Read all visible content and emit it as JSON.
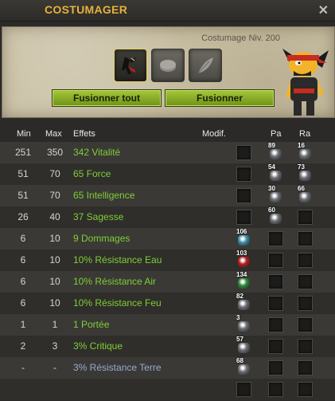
{
  "window": {
    "title": "COSTUMAGER",
    "close_glyph": "✕"
  },
  "header": {
    "level_text": "Costumage Niv. 200"
  },
  "slots": [
    {
      "icon": "dark-costume-item-icon",
      "selected": true
    },
    {
      "icon": "round-stone-icon",
      "selected": false
    },
    {
      "icon": "feather-icon",
      "selected": false
    }
  ],
  "buttons": {
    "merge_all": "Fusionner tout",
    "merge": "Fusionner"
  },
  "table": {
    "headers": {
      "min": "Min",
      "max": "Max",
      "effects": "Effets",
      "modif": "Modif.",
      "pa": "Pa",
      "ra": "Ra"
    },
    "rows": [
      {
        "min": "251",
        "max": "350",
        "effect": "342 Vitalité",
        "color": "green",
        "modif_rune": null,
        "pa": "89",
        "ra": "16"
      },
      {
        "min": "51",
        "max": "70",
        "effect": "65 Force",
        "color": "green",
        "modif_rune": null,
        "pa": "54",
        "ra": "73"
      },
      {
        "min": "51",
        "max": "70",
        "effect": "65 Intelligence",
        "color": "green",
        "modif_rune": null,
        "pa": "30",
        "ra": "66"
      },
      {
        "min": "26",
        "max": "40",
        "effect": "37 Sagesse",
        "color": "green",
        "modif_rune": null,
        "pa": "60",
        "ra": null
      },
      {
        "min": "6",
        "max": "10",
        "effect": "9 Dommages",
        "color": "green",
        "modif_rune": "106",
        "pa": null,
        "ra": null
      },
      {
        "min": "6",
        "max": "10",
        "effect": "10% Résistance Eau",
        "color": "green",
        "modif_rune": "103",
        "pa": null,
        "ra": null
      },
      {
        "min": "6",
        "max": "10",
        "effect": "10% Résistance Air",
        "color": "green",
        "modif_rune": "134",
        "pa": null,
        "ra": null
      },
      {
        "min": "6",
        "max": "10",
        "effect": "10% Résistance Feu",
        "color": "green",
        "modif_rune": "82",
        "pa": null,
        "ra": null
      },
      {
        "min": "1",
        "max": "1",
        "effect": "1 Portée",
        "color": "green",
        "modif_rune": "3",
        "pa": null,
        "ra": null
      },
      {
        "min": "2",
        "max": "3",
        "effect": "3% Critique",
        "color": "green",
        "modif_rune": "57",
        "pa": null,
        "ra": null
      },
      {
        "min": "-",
        "max": "-",
        "effect": "3% Résistance Terre",
        "color": "blue",
        "modif_rune": "68",
        "pa": null,
        "ra": null
      },
      {
        "min": "",
        "max": "",
        "effect": "",
        "color": "green",
        "modif_rune": null,
        "pa": null,
        "ra": null
      }
    ]
  },
  "colors": {
    "accent_title": "#e8b13a",
    "effect_green": "#7fce35",
    "effect_blue": "#9aa9cf",
    "button_green": "#8cb12a"
  }
}
